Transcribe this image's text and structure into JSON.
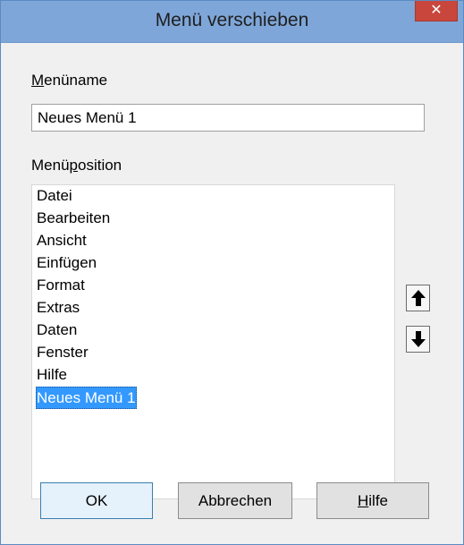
{
  "window": {
    "title": "Menü verschieben",
    "close_glyph": "✕"
  },
  "menuname": {
    "label_mnemonic": "M",
    "label_rest": "enüname",
    "value": "Neues Menü 1"
  },
  "position": {
    "label_before": "Menü",
    "label_mnemonic": "p",
    "label_after": "osition",
    "items": [
      "Datei",
      "Bearbeiten",
      "Ansicht",
      "Einfügen",
      "Format",
      "Extras",
      "Daten",
      "Fenster",
      "Hilfe",
      "Neues Menü 1"
    ],
    "selected": "Neues Menü 1"
  },
  "buttons": {
    "ok": "OK",
    "cancel": "Abbrechen",
    "help_mnemonic": "H",
    "help_rest": "ilfe"
  },
  "icons": {
    "move_up": "arrow-up-icon",
    "move_down": "arrow-down-icon",
    "close": "close-icon"
  },
  "colors": {
    "titlebar": "#7ea6d8",
    "close_button": "#c9463d",
    "selection": "#3399ff"
  }
}
